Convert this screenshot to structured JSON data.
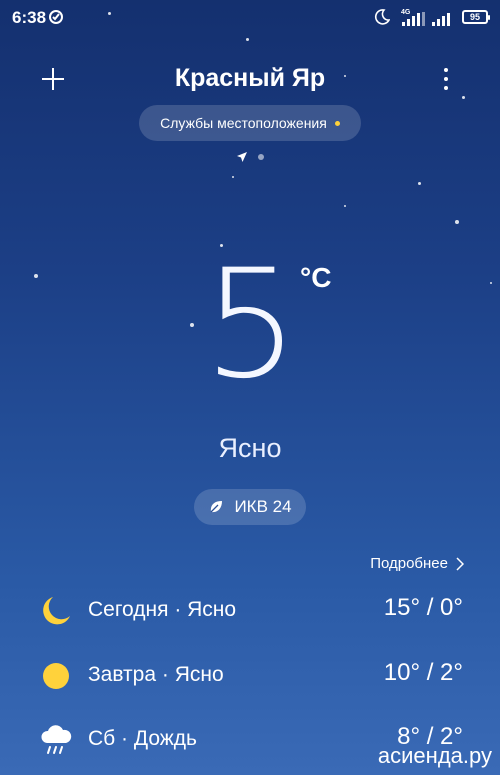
{
  "status_bar": {
    "time": "6:38",
    "network": "4G",
    "battery": "95"
  },
  "header": {
    "city": "Красный Яр",
    "location_service": "Службы местоположения"
  },
  "current": {
    "temperature": "5",
    "unit": "°C",
    "condition": "Ясно",
    "aqi_label": "ИКВ 24"
  },
  "more_link": "Подробнее",
  "forecast": [
    {
      "label": "Сегодня · Ясно",
      "temps": "15° / 0°",
      "icon": "moon-icon"
    },
    {
      "label": "Завтра · Ясно",
      "temps": "10° / 2°",
      "icon": "sun-icon"
    },
    {
      "label": "Сб · Дождь",
      "temps": "8° / 2°",
      "icon": "rain-cloud-icon"
    }
  ],
  "watermark": "асиенда.ру",
  "colors": {
    "accent_yellow": "#ffd23b",
    "bg_top": "#14306f",
    "bg_bottom": "#3a6ab6"
  }
}
